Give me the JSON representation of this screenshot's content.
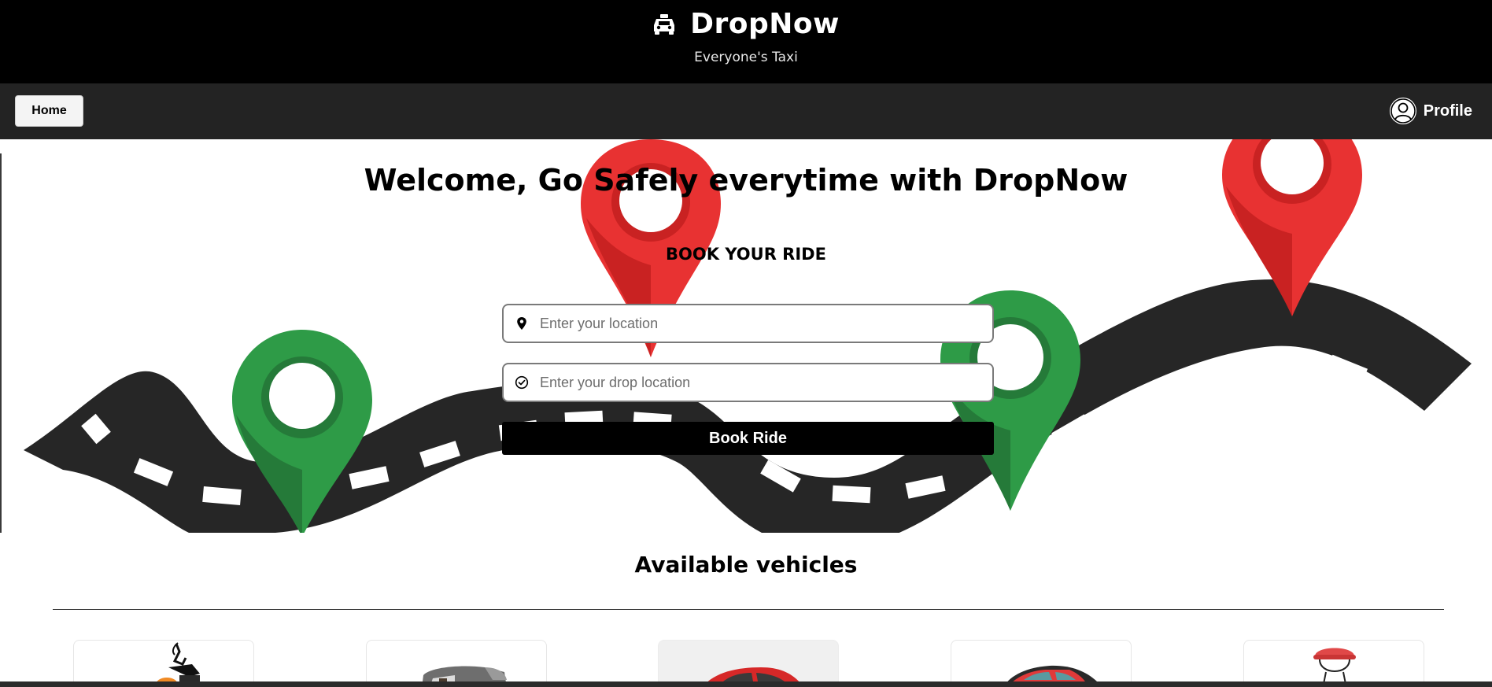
{
  "header": {
    "brand_icon": "taxi-icon",
    "title": "DropNow",
    "tagline": "Everyone's Taxi"
  },
  "nav": {
    "home_label": "Home",
    "profile_icon": "user-circle-icon",
    "profile_label": "Profile"
  },
  "hero": {
    "welcome": "Welcome, Go Safely everytime with DropNow",
    "book_heading": "BOOK YOUR RIDE",
    "pickup": {
      "icon": "map-pin-icon",
      "placeholder": "Enter your location",
      "value": ""
    },
    "drop": {
      "icon": "check-circle-icon",
      "placeholder": "Enter your drop location",
      "value": ""
    },
    "book_button": "Book Ride"
  },
  "vehicles": {
    "heading": "Available vehicles",
    "items": [
      {
        "icon": "scooter-icon"
      },
      {
        "icon": "auto-rickshaw-icon"
      },
      {
        "icon": "hatchback-car-icon"
      },
      {
        "icon": "sports-car-icon"
      },
      {
        "icon": "driver-cap-icon"
      }
    ]
  },
  "colors": {
    "header_bg": "#000000",
    "nav_bg": "#232323",
    "road": "#262626",
    "pin_red": "#e02a2a",
    "pin_green": "#2e9b47",
    "button": "#000000"
  }
}
